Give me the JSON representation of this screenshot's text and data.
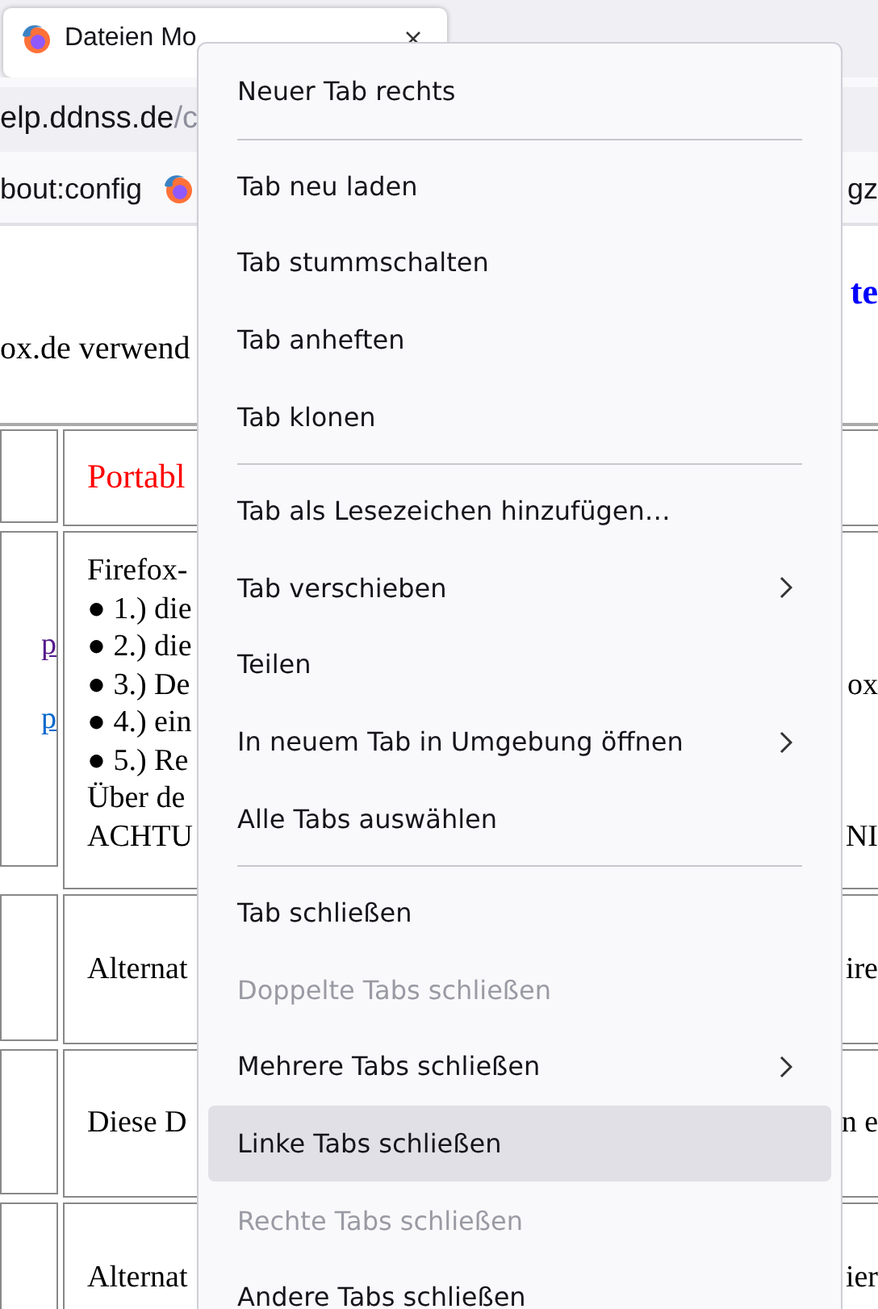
{
  "tab": {
    "title": "Dateien Mo",
    "selected": true
  },
  "address_bar": {
    "host": "elp.ddnss.de",
    "path": "/c"
  },
  "bookmarks_bar": {
    "items_left": [
      {
        "kind": "text",
        "label": "bout:config"
      },
      {
        "kind": "favicon"
      }
    ],
    "items_right": [
      {
        "kind": "text",
        "label": "gz"
      }
    ]
  },
  "page": {
    "heading_fragment": "te",
    "intro_fragment": "ox.de verwend",
    "table": {
      "rows": [
        {
          "kind": "header",
          "links": [],
          "lines": [
            {
              "text": "Portabl"
            }
          ]
        },
        {
          "kind": "body",
          "links": [
            {
              "text": "p",
              "visited": true
            },
            {
              "text": "p",
              "visited": false
            }
          ],
          "lines": [
            {
              "text": "Firefox-"
            },
            {
              "text": "● 1.) die"
            },
            {
              "text": "● 2.) die"
            },
            {
              "text": "● 3.) De",
              "right_text": "ox"
            },
            {
              "text": "● 4.) ein"
            },
            {
              "text": "● 5.) Re"
            },
            {
              "text": "Über de"
            },
            {
              "text": "ACHTU",
              "right_text": "NI"
            }
          ]
        },
        {
          "kind": "body",
          "links": [],
          "lines": [
            {
              "text": "Alternat",
              "right_text": "ire"
            }
          ]
        },
        {
          "kind": "body",
          "links": [],
          "lines": [
            {
              "text": "Diese D",
              "right_text": "n e"
            }
          ]
        },
        {
          "kind": "body",
          "links": [],
          "lines": [
            {
              "text": "Alternat",
              "right_text": "ier"
            }
          ]
        }
      ]
    }
  },
  "menu": {
    "items": [
      {
        "kind": "item",
        "label": "Neuer Tab rechts",
        "disabled": false,
        "submenu": false,
        "selected": false
      },
      {
        "kind": "separator"
      },
      {
        "kind": "item",
        "label": "Tab neu laden",
        "disabled": false,
        "submenu": false,
        "selected": false
      },
      {
        "kind": "item",
        "label": "Tab stummschalten",
        "disabled": false,
        "submenu": false,
        "selected": false
      },
      {
        "kind": "item",
        "label": "Tab anheften",
        "disabled": false,
        "submenu": false,
        "selected": false
      },
      {
        "kind": "item",
        "label": "Tab klonen",
        "disabled": false,
        "submenu": false,
        "selected": false
      },
      {
        "kind": "separator"
      },
      {
        "kind": "item",
        "label": "Tab als Lesezeichen hinzufügen…",
        "disabled": false,
        "submenu": false,
        "selected": false
      },
      {
        "kind": "item",
        "label": "Tab verschieben",
        "disabled": false,
        "submenu": true,
        "selected": false
      },
      {
        "kind": "item",
        "label": "Teilen",
        "disabled": false,
        "submenu": false,
        "selected": false
      },
      {
        "kind": "item",
        "label": "In neuem Tab in Umgebung öffnen",
        "disabled": false,
        "submenu": true,
        "selected": false
      },
      {
        "kind": "item",
        "label": "Alle Tabs auswählen",
        "disabled": false,
        "submenu": false,
        "selected": false
      },
      {
        "kind": "separator"
      },
      {
        "kind": "item",
        "label": "Tab schließen",
        "disabled": false,
        "submenu": false,
        "selected": false
      },
      {
        "kind": "item",
        "label": "Doppelte Tabs schließen",
        "disabled": true,
        "submenu": false,
        "selected": false
      },
      {
        "kind": "item",
        "label": "Mehrere Tabs schließen",
        "disabled": false,
        "submenu": true,
        "selected": false
      },
      {
        "kind": "item",
        "label": "Linke Tabs schließen",
        "disabled": false,
        "submenu": false,
        "selected": true
      },
      {
        "kind": "item",
        "label": "Rechte Tabs schließen",
        "disabled": true,
        "submenu": false,
        "selected": false
      },
      {
        "kind": "item",
        "label": "Andere Tabs schließen",
        "disabled": false,
        "submenu": false,
        "selected": false
      }
    ]
  }
}
